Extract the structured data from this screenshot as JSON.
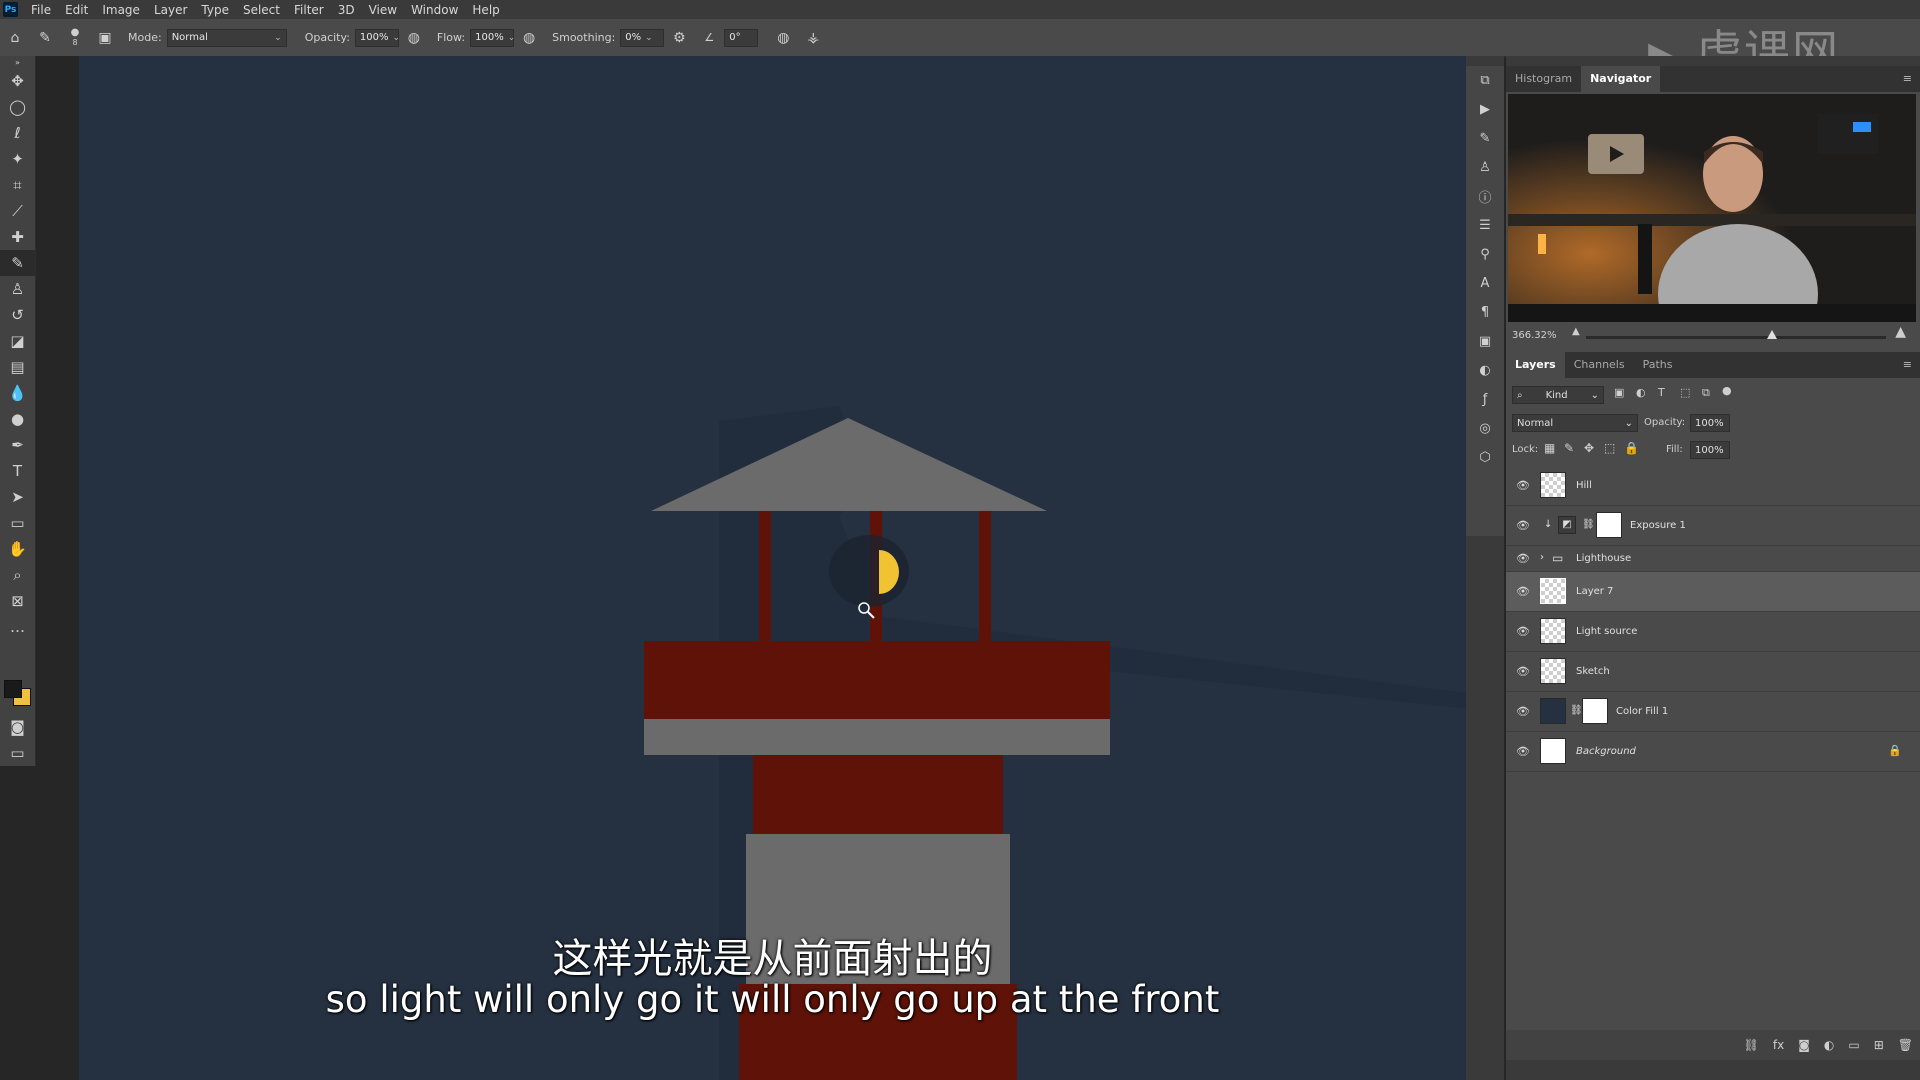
{
  "menu": [
    "File",
    "Edit",
    "Image",
    "Layer",
    "Type",
    "Select",
    "Filter",
    "3D",
    "View",
    "Window",
    "Help"
  ],
  "app_logo": "Ps",
  "watermark": "虎课网",
  "options": {
    "brush_size": "8",
    "mode_label": "Mode:",
    "mode_value": "Normal",
    "opacity_label": "Opacity:",
    "opacity_value": "100%",
    "flow_label": "Flow:",
    "flow_value": "100%",
    "smoothing_label": "Smoothing:",
    "smoothing_value": "0%",
    "angle_value": "0°"
  },
  "tools": [
    "move-tool",
    "marquee-tool",
    "lasso-tool",
    "magic-wand-tool",
    "crop-tool",
    "eyedropper-tool",
    "healing-tool",
    "brush-tool",
    "clone-stamp-tool",
    "history-brush-tool",
    "eraser-tool",
    "gradient-tool",
    "blur-tool",
    "dodge-tool",
    "pen-tool",
    "type-tool",
    "path-select-tool",
    "rectangle-tool",
    "hand-tool",
    "zoom-tool",
    "frame-tool",
    "more-tools"
  ],
  "colors": {
    "canvas_bg": "#253141",
    "roof": "#6b6b6b",
    "red": "#5e1208",
    "gray_band": "#6b6b6b",
    "lamp": "#f1c232",
    "foreground": "#1a1a1a",
    "background": "#f0c040"
  },
  "subtitles": {
    "chinese": "这样光就是从前面射出的",
    "english": "so light will only go it will only go up at the front"
  },
  "navigator": {
    "tabs": [
      "Histogram",
      "Navigator"
    ],
    "active_tab": "Navigator",
    "zoom": "366.32%",
    "zoom_slider_value": 0.62
  },
  "layers_panel": {
    "tabs": [
      "Layers",
      "Channels",
      "Paths"
    ],
    "active_tab": "Layers",
    "filter_kind": "Kind",
    "blend_mode": "Normal",
    "opacity_label": "Opacity:",
    "opacity_value": "100%",
    "lock_label": "Lock:",
    "fill_label": "Fill:",
    "fill_value": "100%",
    "layers": [
      {
        "name": "Hill",
        "type": "pixel",
        "selected": false
      },
      {
        "name": "Exposure 1",
        "type": "adjustment",
        "selected": false
      },
      {
        "name": "Lighthouse",
        "type": "group",
        "selected": false
      },
      {
        "name": "Layer 7",
        "type": "pixel",
        "selected": true
      },
      {
        "name": "Light source",
        "type": "pixel",
        "selected": false
      },
      {
        "name": "Sketch",
        "type": "pixel",
        "selected": false
      },
      {
        "name": "Color Fill 1",
        "type": "fill",
        "selected": false
      },
      {
        "name": "Background",
        "type": "background",
        "selected": false
      }
    ]
  }
}
